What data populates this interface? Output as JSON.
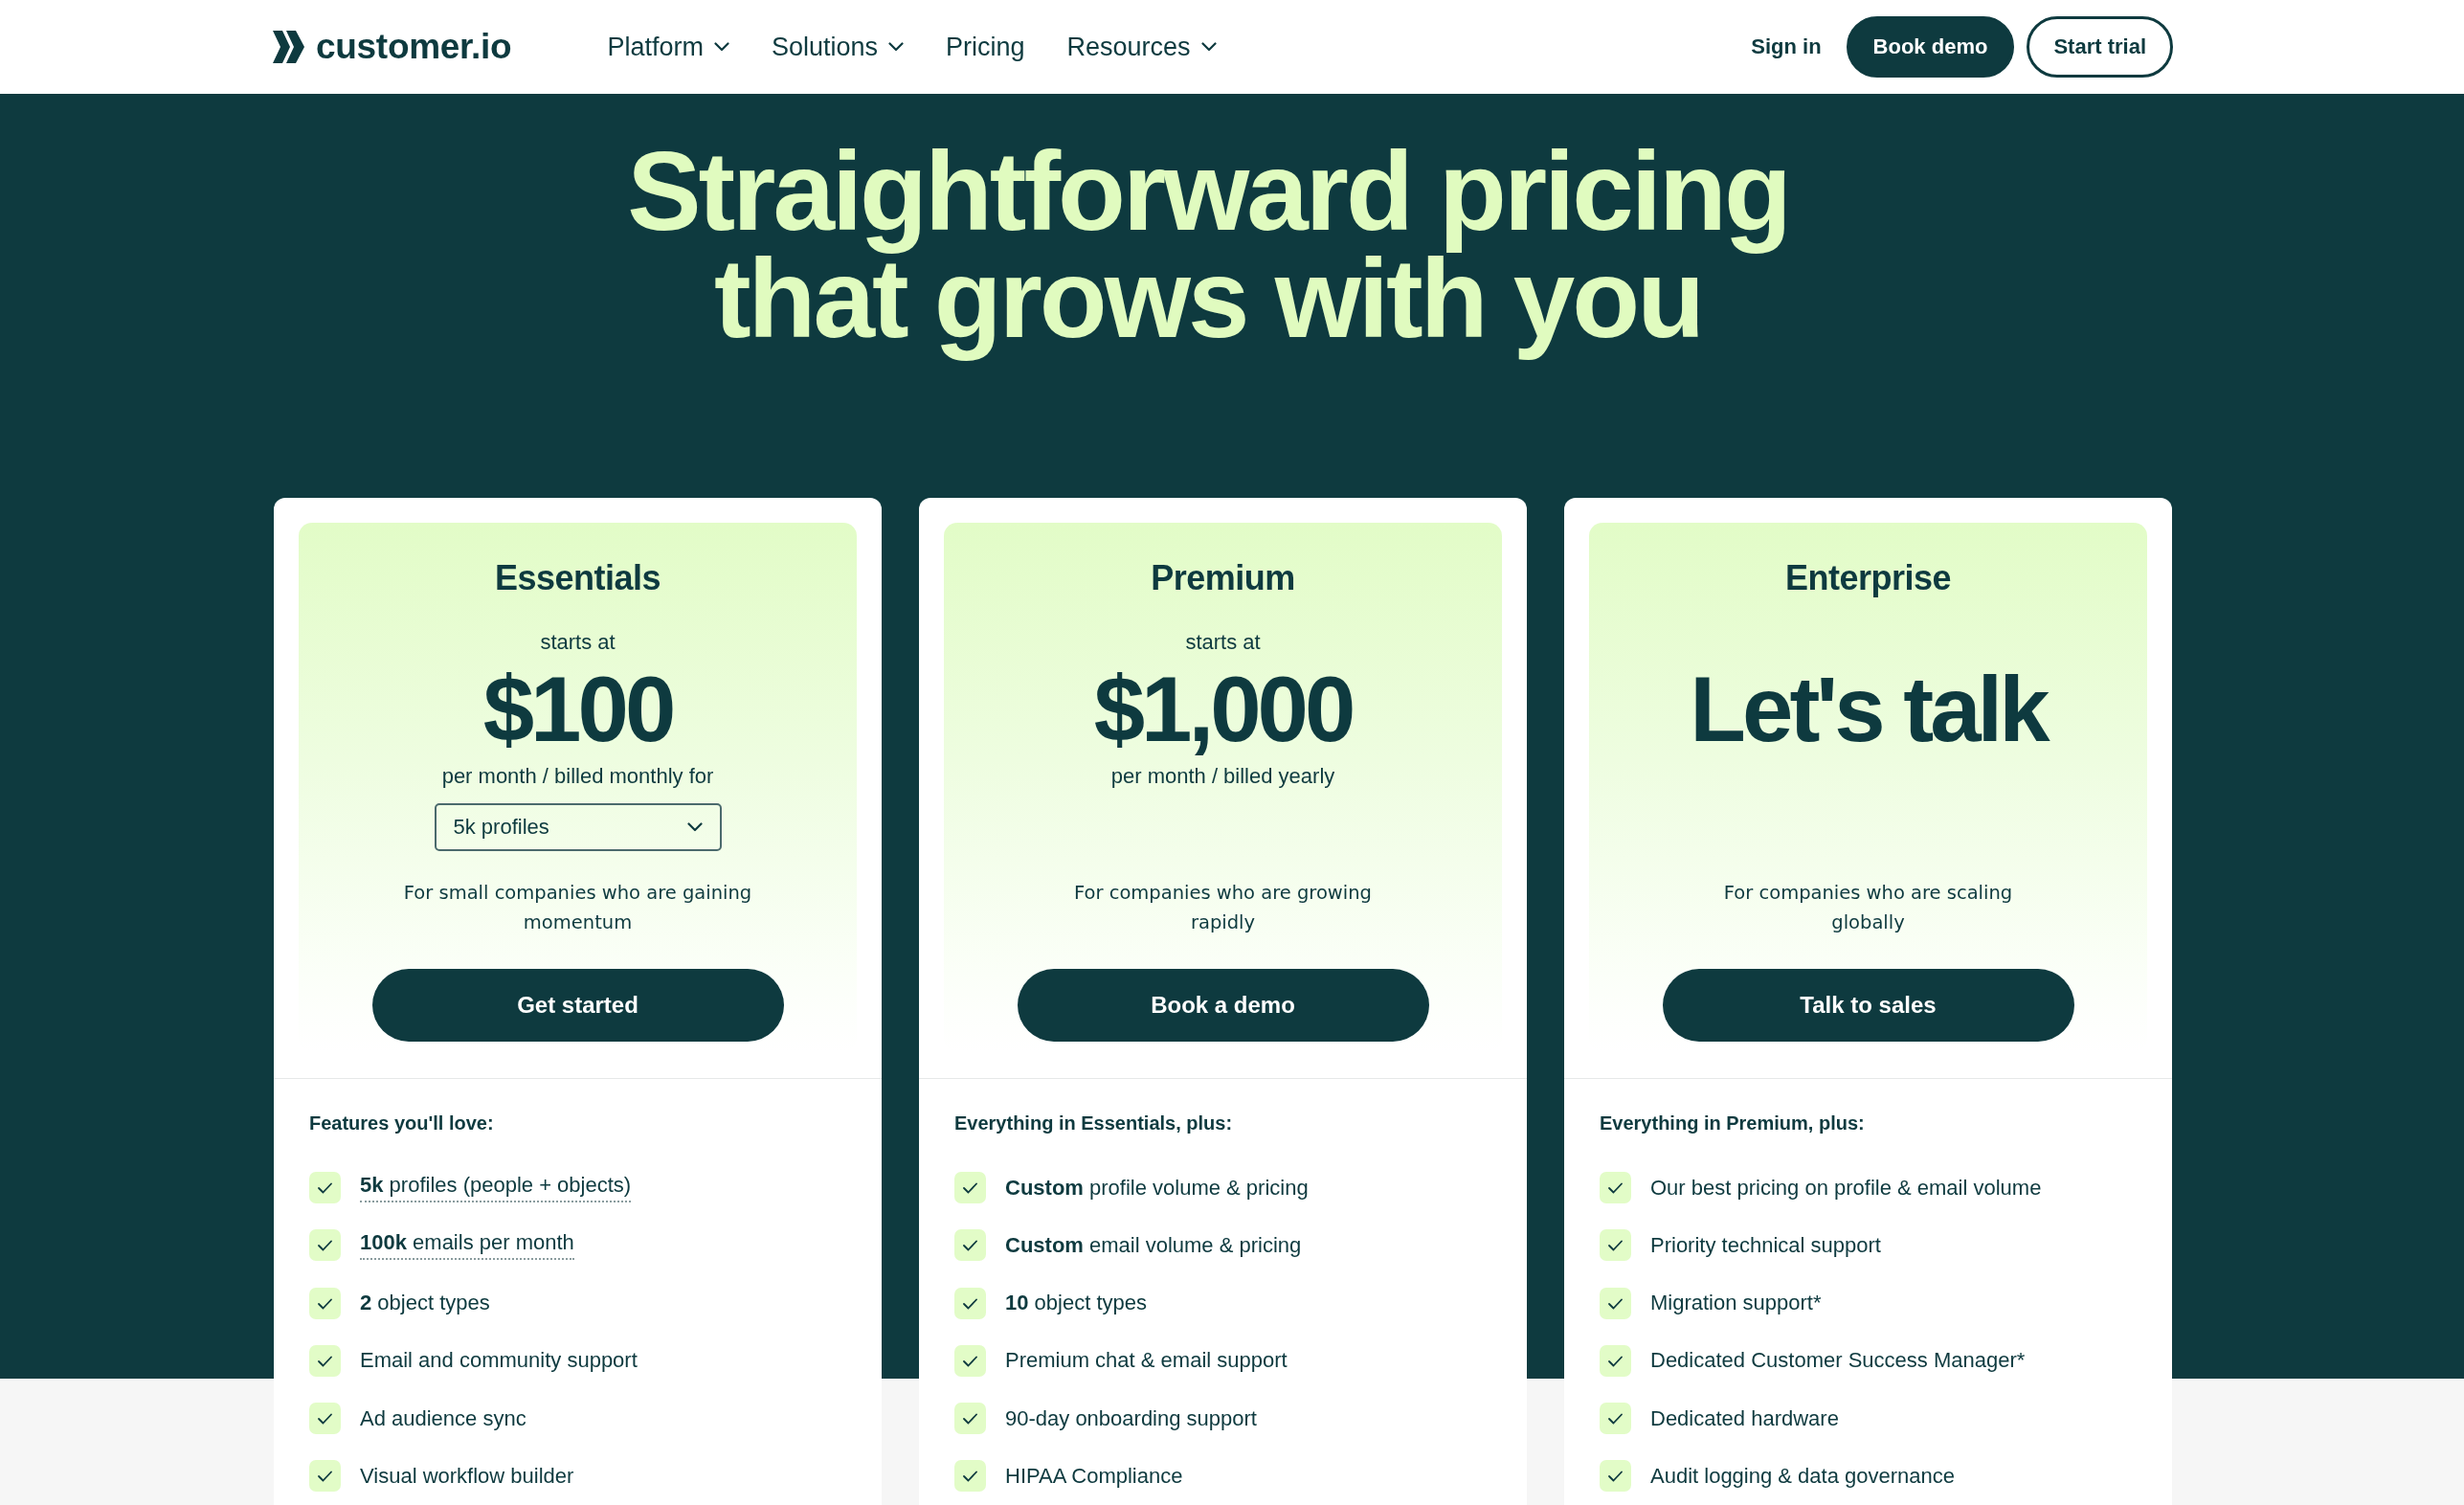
{
  "header": {
    "brand": "customer.io",
    "nav": [
      {
        "label": "Platform",
        "dropdown": true
      },
      {
        "label": "Solutions",
        "dropdown": true
      },
      {
        "label": "Pricing",
        "dropdown": false
      },
      {
        "label": "Resources",
        "dropdown": true
      }
    ],
    "actions": [
      {
        "label": "Sign in",
        "kind": "link"
      },
      {
        "label": "Book demo",
        "kind": "filled"
      },
      {
        "label": "Start trial",
        "kind": "outline"
      }
    ]
  },
  "hero": {
    "title": "Straightforward pricing that grows with you"
  },
  "plans": [
    {
      "name": "Essentials",
      "starts_at": "starts at",
      "price": "$100",
      "billing": "per month / billed monthly for",
      "select": {
        "value": "5k profiles"
      },
      "description": "For small companies who are gaining momentum",
      "cta": "Get started",
      "features_heading": "Features you'll love:",
      "features": [
        {
          "text": "**5k** profiles (people + objects)",
          "tooltip": true
        },
        {
          "text": "**100k** emails per month",
          "tooltip": true
        },
        {
          "text": "**2** object types",
          "tooltip": false
        },
        {
          "text": "Email and community support",
          "tooltip": false
        },
        {
          "text": "Ad audience sync",
          "tooltip": false
        },
        {
          "text": "Visual workflow builder",
          "tooltip": false
        }
      ]
    },
    {
      "name": "Premium",
      "starts_at": "starts at",
      "price": "$1,000",
      "billing": "per month / billed yearly",
      "description": "For companies who are growing rapidly",
      "cta": "Book a demo",
      "features_heading": "Everything in Essentials, plus:",
      "features": [
        {
          "text": "**Custom** profile volume & pricing",
          "tooltip": false
        },
        {
          "text": "**Custom** email volume & pricing",
          "tooltip": false
        },
        {
          "text": "**10** object types",
          "tooltip": false
        },
        {
          "text": "Premium chat & email support",
          "tooltip": false
        },
        {
          "text": "90-day onboarding support",
          "tooltip": false
        },
        {
          "text": "HIPAA Compliance",
          "tooltip": false
        }
      ]
    },
    {
      "name": "Enterprise",
      "price": "Let's talk",
      "description": "For companies who are scaling globally",
      "cta": "Talk to sales",
      "features_heading": "Everything in Premium, plus:",
      "features": [
        {
          "text": "Our best pricing on profile & email volume",
          "tooltip": false
        },
        {
          "text": "Priority technical support",
          "tooltip": false
        },
        {
          "text": "Migration support*",
          "tooltip": false
        },
        {
          "text": "Dedicated Customer Success Manager*",
          "tooltip": false
        },
        {
          "text": "Dedicated hardware",
          "tooltip": false
        },
        {
          "text": "Audit logging & data governance",
          "tooltip": false
        }
      ]
    }
  ]
}
